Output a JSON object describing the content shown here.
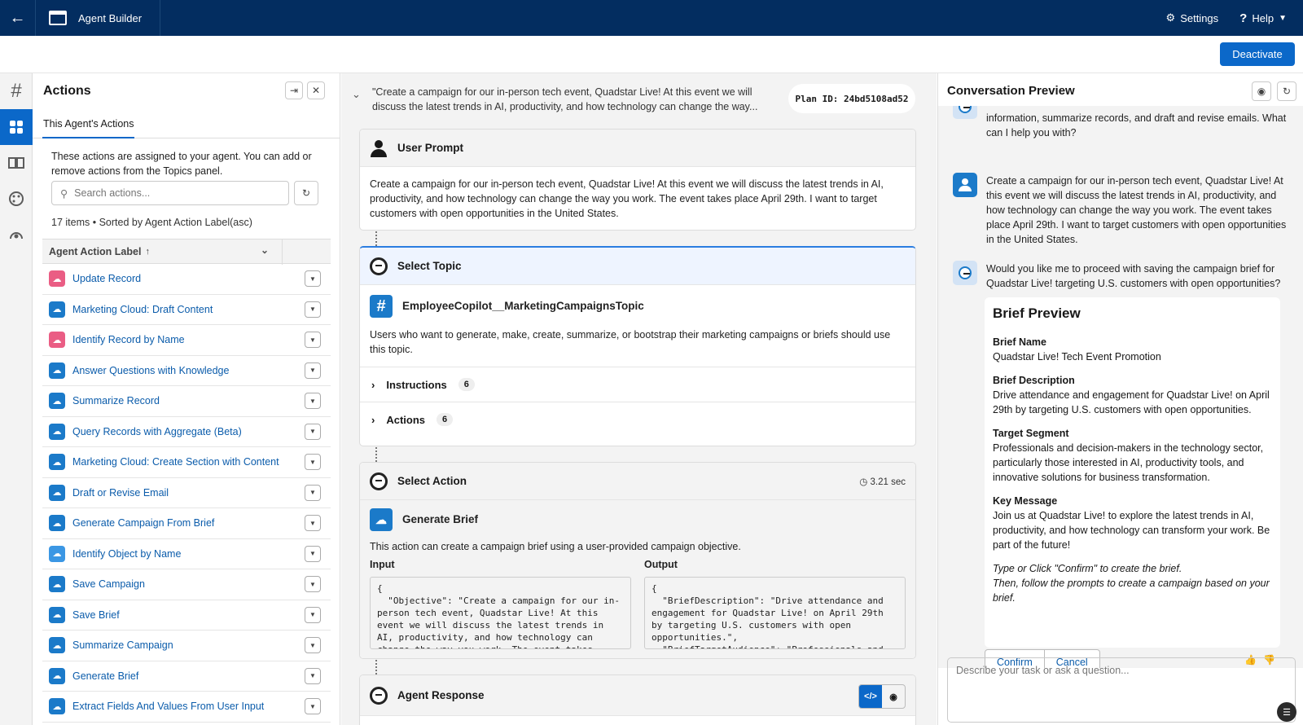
{
  "topbar": {
    "app_title": "Agent Builder",
    "settings": "Settings",
    "help": "Help"
  },
  "subbar": {
    "deactivate": "Deactivate"
  },
  "rail": {
    "items": [
      "hash-icon",
      "actions-icon",
      "library-icon",
      "palette-icon",
      "analytics-icon"
    ]
  },
  "actions_panel": {
    "title": "Actions",
    "tab": "This Agent's Actions",
    "description": "These actions are assigned to your agent. You can add or remove actions from the Topics panel.",
    "search_placeholder": "Search actions...",
    "count": "17 items • Sorted by Agent Action Label(asc)",
    "column_header": "Agent Action Label",
    "rows": [
      {
        "label": "Update Record",
        "color": "#ea5d84"
      },
      {
        "label": "Marketing Cloud: Draft Content",
        "color": "#1b7ac9"
      },
      {
        "label": "Identify Record by Name",
        "color": "#ea5d84"
      },
      {
        "label": "Answer Questions with Knowledge",
        "color": "#1b7ac9"
      },
      {
        "label": "Summarize Record",
        "color": "#1b7ac9"
      },
      {
        "label": "Query Records with Aggregate (Beta)",
        "color": "#1b7ac9"
      },
      {
        "label": "Marketing Cloud: Create Section with Content",
        "color": "#1b7ac9"
      },
      {
        "label": "Draft or Revise Email",
        "color": "#1b7ac9"
      },
      {
        "label": "Generate Campaign From Brief",
        "color": "#1b7ac9"
      },
      {
        "label": "Identify Object by Name",
        "color": "#3b97e4"
      },
      {
        "label": "Save Campaign",
        "color": "#1b7ac9"
      },
      {
        "label": "Save Brief",
        "color": "#1b7ac9"
      },
      {
        "label": "Summarize Campaign",
        "color": "#1b7ac9"
      },
      {
        "label": "Generate Brief",
        "color": "#1b7ac9"
      },
      {
        "label": "Extract Fields And Values From User Input",
        "color": "#1b7ac9"
      }
    ]
  },
  "plan": {
    "summary": "\"Create a campaign for our in-person tech event, Quadstar Live! At this event we will discuss the latest trends in AI, productivity, and how technology can change the way...",
    "plan_id": "Plan ID: 24bd5108ad52",
    "user_prompt": {
      "title": "User Prompt",
      "text": "Create a campaign for our in-person tech event, Quadstar Live! At this event we will discuss the latest trends in AI, productivity, and how technology can change the way you work. The event takes place April 29th. I want to target customers with open opportunities in the United States."
    },
    "select_topic": {
      "title": "Select Topic",
      "topic_name": "EmployeeCopilot__MarketingCampaignsTopic",
      "description": "Users who want to generate, make, create, summarize, or bootstrap their marketing campaigns or briefs should use this topic.",
      "instructions_label": "Instructions",
      "instructions_count": "6",
      "actions_label": "Actions",
      "actions_count": "6"
    },
    "select_action": {
      "title": "Select Action",
      "duration": "3.21 sec",
      "action_name": "Generate Brief",
      "description": "This action can create a campaign brief using a user-provided campaign objective.",
      "input_label": "Input",
      "output_label": "Output",
      "input_json": "{\n  \"Objective\": \"Create a campaign for our in-\nperson tech event, Quadstar Live! At this\nevent we will discuss the latest trends in\nAI, productivity, and how technology can\nchange the way you work. The event takes",
      "output_json": "{\n  \"BriefDescription\": \"Drive attendance and\nengagement for Quadstar Live! on April 29th\nby targeting U.S. customers with open\nopportunities.\",\n  \"BriefTargetAudience\": \"Professionals and"
    },
    "agent_response": {
      "title": "Agent Response"
    }
  },
  "preview": {
    "title": "Conversation Preview",
    "bot_intro": "information, summarize records, and draft and revise emails. What can I help you with?",
    "user_message": "Create a campaign for our in-person tech event, Quadstar Live! At this event we will discuss the latest trends in AI, productivity, and how technology can change the way you work. The event takes place April 29th. I want to target customers with open opportunities in the United States.",
    "bot_question": "Would you like me to proceed with saving the campaign brief for Quadstar Live! targeting U.S. customers with open opportunities?",
    "brief": {
      "heading": "Brief Preview",
      "name_label": "Brief Name",
      "name_value": "Quadstar Live! Tech Event Promotion",
      "desc_label": "Brief Description",
      "desc_value": "Drive attendance and engagement for Quadstar Live! on April 29th by targeting U.S. customers with open opportunities.",
      "segment_label": "Target Segment",
      "segment_value": "Professionals and decision-makers in the technology sector, particularly those interested in AI, productivity tools, and innovative solutions for business transformation.",
      "message_label": "Key Message",
      "message_value": "Join us at Quadstar Live! to explore the latest trends in AI, productivity, and how technology can transform your work. Be part of the future!",
      "instruction_1": "Type or Click \"Confirm\" to create the brief.",
      "instruction_2": "Then, follow the prompts to create a campaign based on your brief.",
      "confirm": "Confirm",
      "cancel": "Cancel"
    },
    "input_placeholder": "Describe your task or ask a question..."
  }
}
